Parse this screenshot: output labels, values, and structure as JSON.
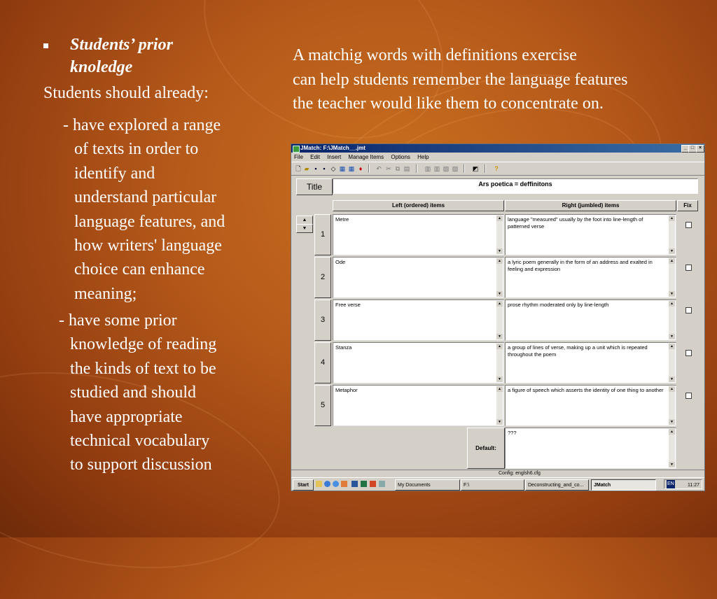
{
  "slide": {
    "bullet_title": "Students’ prior knoledge",
    "lead": "Students should already:",
    "para1_first": "- have explored a range",
    "para1_rest": [
      "of texts in order to",
      "identify and",
      "understand particular",
      "language features, and",
      "how writers' language",
      "choice can enhance",
      "meaning;"
    ],
    "para2_first": "- have some prior",
    "para2_rest": [
      "knowledge of reading",
      "the kinds of text to be",
      "studied and should",
      "have appropriate",
      "technical vocabulary",
      "to support discussion"
    ],
    "intro_lines": [
      "A matchig words with definitions exercise",
      "can help students remember the language features",
      "the teacher would like them to concentrate on."
    ]
  },
  "app": {
    "window_title": "JMatch: F:\\JMatch__.jmt",
    "menu": [
      "File",
      "Edit",
      "Insert",
      "Manage Items",
      "Options",
      "Help"
    ],
    "title_button": "Title",
    "title_value": "Ars poetica = deffinitons",
    "headers": {
      "left": "Left (ordered) items",
      "right": "Right (jumbled) items",
      "fix": "Fix"
    },
    "rows": [
      {
        "num": "1",
        "left": "Metre",
        "right": "language \"measured\" usually by the foot into line-length of patterned verse"
      },
      {
        "num": "2",
        "left": "Ode",
        "right": "a lyric poem generally in the form of an address and exalted in feeling and expression"
      },
      {
        "num": "3",
        "left": "Free verse",
        "right": " prose rhythm moderated only by line-length"
      },
      {
        "num": "4",
        "left": "Stanza",
        "right": "a group of lines of verse, making up a unit which is repeated throughout the poem"
      },
      {
        "num": "5",
        "left": "Metaphor",
        "right": "a figure of speech which asserts the identity of one thing to another"
      }
    ],
    "default_label": "Default:",
    "default_value": "???",
    "status": "Config: englsh6.cfg",
    "taskbar": {
      "start": "Start",
      "tasks": [
        "My Documents",
        "F:\\",
        "Deconstructing_and_co...",
        "JMatch"
      ],
      "lang": "EN",
      "clock": "11:27"
    }
  }
}
